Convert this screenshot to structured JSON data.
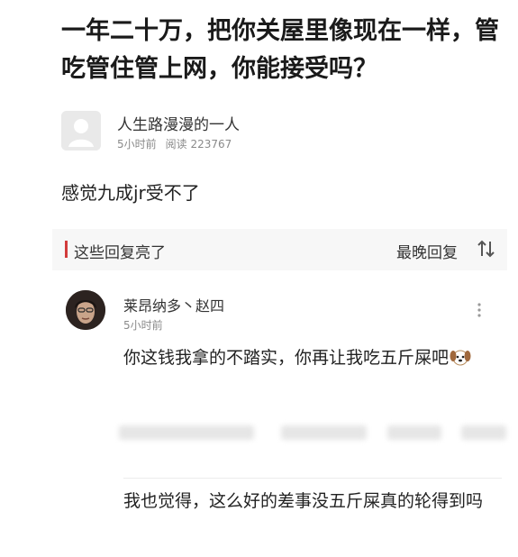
{
  "article": {
    "title": "一年二十万，把你关屋里像现在一样，管吃管住管上网，你能接受吗？",
    "author_name": "人生路漫漫的一人",
    "post_time": "5小时前",
    "read_label": "阅读 223767",
    "body": "感觉九成jr受不了"
  },
  "replies_bar": {
    "left_label": "这些回复亮了",
    "right_label": "最晚回复",
    "sort_icon": "sort-arrows-icon",
    "accent_color": "#d23b3b"
  },
  "comment": {
    "user": "莱昂纳多丶赵四",
    "time": "5小时前",
    "text": "你这钱我拿的不踏实，你再让我吃五斤屎吧",
    "emoji": "dog-face-icon",
    "reply_text": "我也觉得，这么好的差事没五斤屎真的轮得到吗"
  },
  "colors": {
    "text_primary": "#222222",
    "text_secondary": "#8a8a8a",
    "bar_background": "#f7f7f7"
  }
}
